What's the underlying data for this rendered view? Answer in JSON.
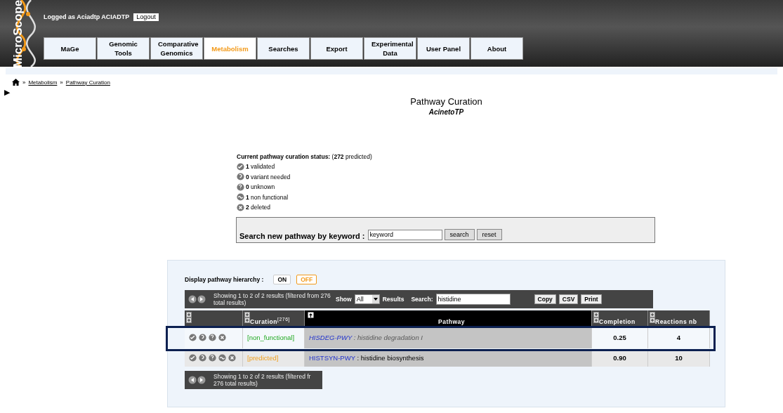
{
  "header": {
    "logo_text": "MicroScope",
    "login_text": "Logged as Aciadtp ACIADTP",
    "logout": "Logout",
    "nav": [
      {
        "label": "MaGe",
        "selected": false
      },
      {
        "label": "Genomic Tools",
        "selected": false
      },
      {
        "label": "Comparative Genomics",
        "selected": false
      },
      {
        "label": "Metabolism",
        "selected": true
      },
      {
        "label": "Searches",
        "selected": false
      },
      {
        "label": "Export",
        "selected": false
      },
      {
        "label": "Experimental Data",
        "selected": false
      },
      {
        "label": "User Panel",
        "selected": false
      },
      {
        "label": "About",
        "selected": false
      }
    ]
  },
  "breadcrumb": [
    {
      "label": "Metabolism"
    },
    {
      "label": "Pathway Curation"
    }
  ],
  "breadcrumb_sep": "»",
  "expander": "▶",
  "title": "Pathway Curation",
  "subtitle": "AcinetoTP",
  "status": {
    "heading": "Current pathway curation status:",
    "predicted_note": "(**272** predicted)",
    "items": [
      {
        "kind": "check",
        "count": "1",
        "label": "validated"
      },
      {
        "kind": "variant",
        "count": "0",
        "label": "variant needed"
      },
      {
        "kind": "unknown",
        "count": "0",
        "label": "unknown"
      },
      {
        "kind": "tilde",
        "count": "1",
        "label": "non functional"
      },
      {
        "kind": "cross",
        "count": "2",
        "label": "deleted"
      }
    ]
  },
  "keyword_search": {
    "label": "Search new pathway by keyword :",
    "value": "keyword",
    "buttons": [
      "search",
      "reset"
    ]
  },
  "hierarchy": {
    "label": "Display pathway hierarchy :",
    "options": [
      {
        "label": "ON",
        "selected": false
      },
      {
        "label": "OFF",
        "selected": true
      }
    ]
  },
  "toolbar": {
    "info": "Showing 1 to 2 of 2 results (filtered from 276 total results)",
    "show_label": "Show",
    "show_value": "All",
    "results_label": "Results",
    "search_label": "Search:",
    "search_value": "histidine",
    "buttons": [
      "Copy",
      "CSV",
      "Print"
    ]
  },
  "table": {
    "name_separator": ":",
    "columns": [
      {},
      {
        "label": "Curation",
        "sup": "[276]"
      },
      {
        "label": "Pathway"
      },
      {
        "label": "Completion"
      },
      {
        "label": "Reactions nb"
      }
    ],
    "rows": [
      {
        "highlighted": true,
        "actions": [
          {
            "kind": "check"
          },
          {
            "kind": "variant"
          },
          {
            "kind": "unknown"
          },
          {
            "kind": "cross"
          }
        ],
        "curation": "[non_functional]",
        "kind": "non_functional",
        "pathway_id": "HISDEG-PWY",
        "pathway_name": "histidine degradation I",
        "faded": true,
        "completion": "0.25",
        "reactions": "4"
      },
      {
        "highlighted": false,
        "actions": [
          {
            "kind": "check"
          },
          {
            "kind": "variant"
          },
          {
            "kind": "unknown"
          },
          {
            "kind": "tilde"
          },
          {
            "kind": "cross"
          }
        ],
        "curation": "[predicted]",
        "kind": "predicted",
        "pathway_id": "HISTSYN-PWY",
        "pathway_name": "histidine biosynthesis",
        "faded": false,
        "completion": "0.90",
        "reactions": "10"
      }
    ]
  },
  "bottom_info": "Showing 1 to 2 of 2 results (filtered fr 276 total results)"
}
